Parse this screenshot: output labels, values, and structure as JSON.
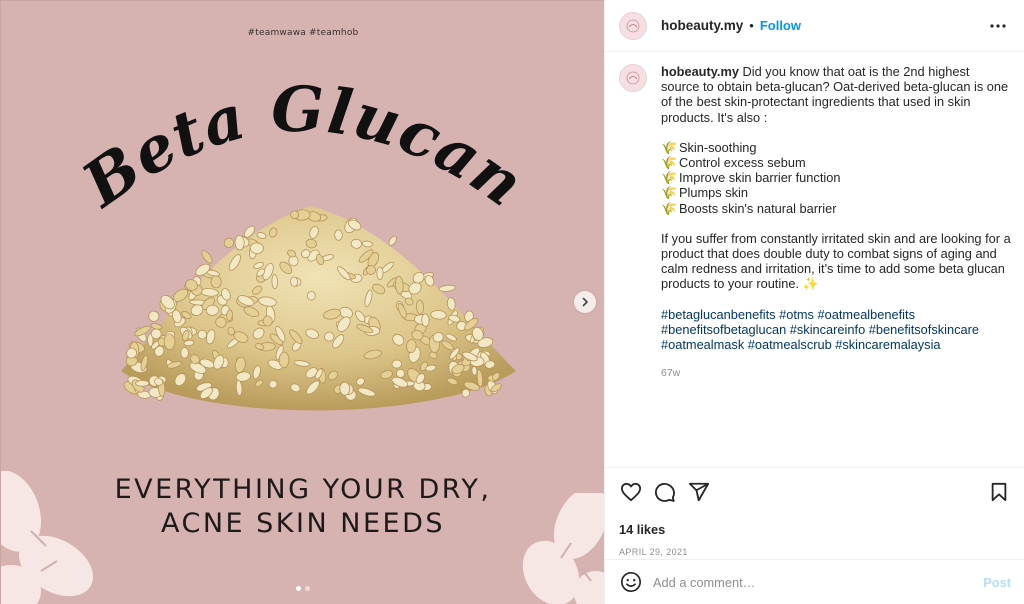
{
  "post": {
    "media": {
      "hashtags": "#teamwawa #teamhob",
      "headline": "Beta Glucan",
      "tagline_line1": "EVERYTHING YOUR DRY,",
      "tagline_line2": "ACNE SKIN NEEDS",
      "carousel": {
        "current": 1,
        "total": 2
      },
      "background_color": "#d6b3b0"
    },
    "header": {
      "username": "hobeauty.my",
      "separator": "•",
      "follow_label": "Follow",
      "more_icon": "more-horizontal-icon"
    },
    "caption": {
      "username": "hobeauty.my",
      "intro": "Did you know that oat is the 2nd highest source to obtain beta-glucan? Oat-derived beta-glucan is one of the best skin-protectant ingredients that used in skin products. It's also :",
      "bullet_emoji": "🌾",
      "benefits": [
        "Skin-soothing",
        "Control excess sebum",
        "Improve skin barrier function",
        "Plumps skin",
        "Boosts skin's natural barrier"
      ],
      "paragraph": "If you suffer from constantly irritated skin and are looking for a product that does double duty to combat signs of aging and calm redness and irritation, it's time to add some beta glucan products to your routine. ✨",
      "tags_line1": "#betaglucanbenefits #otms #oatmealbenefits",
      "tags_line2": "#benefitsofbetaglucan #skincareinfo #benefitsofskincare",
      "tags_line3": "#oatmealmask #oatmealscrub #skincaremalaysia",
      "age": "67w"
    },
    "actions": {
      "like_icon": "heart-icon",
      "comment_icon": "comment-icon",
      "share_icon": "share-icon",
      "save_icon": "bookmark-icon"
    },
    "likes": "14 likes",
    "date": "APRIL 29, 2021",
    "comment_box": {
      "emoji_icon": "emoji-icon",
      "placeholder": "Add a comment…",
      "post_label": "Post"
    },
    "colors": {
      "link": "#0095f6",
      "hashtag": "#00376b",
      "muted": "#8e8e8e",
      "post_disabled": "#b2dffc"
    }
  }
}
